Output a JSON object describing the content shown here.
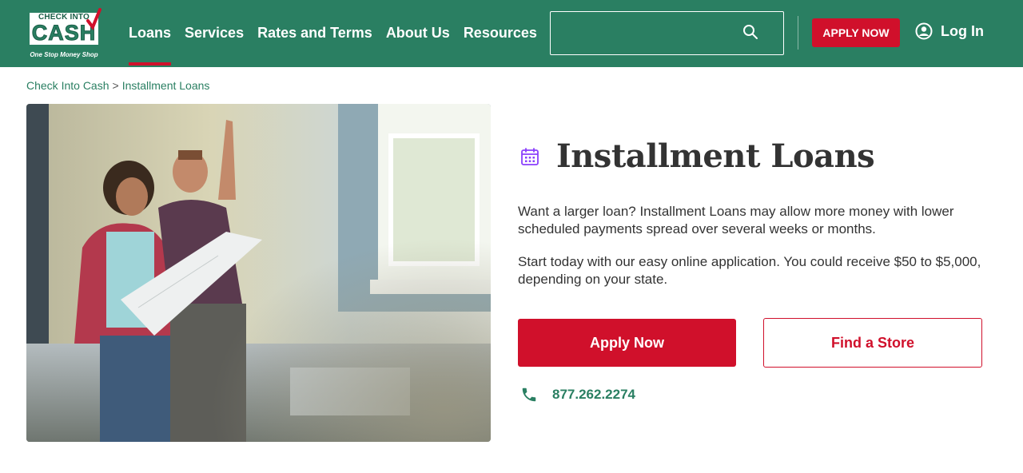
{
  "brand": {
    "logo_top": "CHECK INTO",
    "logo_main": "CASH",
    "tagline": "One Stop Money Shop",
    "colors": {
      "primary_green": "#2a7f62",
      "accent_red": "#d0102b",
      "title_dark": "#333333"
    }
  },
  "nav": {
    "items": [
      {
        "label": "Loans",
        "active": true
      },
      {
        "label": "Services"
      },
      {
        "label": "Rates and Terms"
      },
      {
        "label": "About Us"
      },
      {
        "label": "Resources"
      }
    ]
  },
  "search": {
    "placeholder": "",
    "icon": "search-icon"
  },
  "header_actions": {
    "apply_label": "APPLY NOW",
    "login_label": "Log In",
    "login_icon": "user-circle-icon"
  },
  "breadcrumb": {
    "home": "Check Into Cash",
    "separator": ">",
    "current": "Installment Loans"
  },
  "hero": {
    "image_alt": "Couple reviewing renovation plans in a room"
  },
  "content": {
    "title": "Installment Loans",
    "title_icon": "calendar-icon",
    "para1": "Want a larger loan? Installment Loans may allow more money with lower scheduled payments spread over several weeks or months.",
    "para2": "Start today with our easy online application. You could receive $50 to $5,000, depending on your state.",
    "apply_label": "Apply Now",
    "store_label": "Find a Store",
    "phone": "877.262.2274",
    "phone_icon": "phone-icon"
  }
}
